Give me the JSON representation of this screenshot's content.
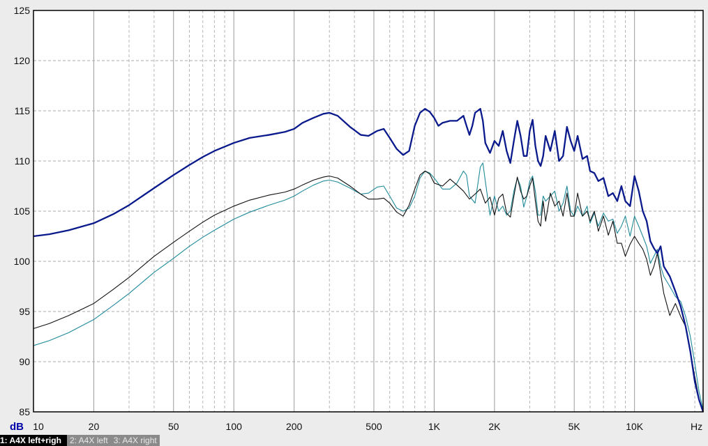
{
  "chart_data": {
    "type": "line",
    "xscale": "log",
    "xlim": [
      10,
      22000
    ],
    "ylim": [
      85,
      125
    ],
    "x_unit_label": "Hz",
    "y_unit_label": "dB",
    "y_ticks": [
      125,
      120,
      115,
      110,
      105,
      100,
      95,
      90,
      85
    ],
    "x_ticks": [
      {
        "value": 10,
        "label": "10"
      },
      {
        "value": 20,
        "label": "20"
      },
      {
        "value": 50,
        "label": "50"
      },
      {
        "value": 100,
        "label": "100"
      },
      {
        "value": 200,
        "label": "200"
      },
      {
        "value": 500,
        "label": "500"
      },
      {
        "value": 1000,
        "label": "1K"
      },
      {
        "value": 2000,
        "label": "2K"
      },
      {
        "value": 5000,
        "label": "5K"
      },
      {
        "value": 10000,
        "label": "10K"
      }
    ],
    "grid": true,
    "series": [
      {
        "name": "1: A4X left+righ",
        "color": "#0a1a8c",
        "points": [
          [
            10,
            102.5
          ],
          [
            12,
            102.7
          ],
          [
            15,
            103.1
          ],
          [
            20,
            103.8
          ],
          [
            25,
            104.7
          ],
          [
            30,
            105.6
          ],
          [
            40,
            107.3
          ],
          [
            50,
            108.6
          ],
          [
            60,
            109.6
          ],
          [
            70,
            110.4
          ],
          [
            80,
            111.0
          ],
          [
            100,
            111.8
          ],
          [
            120,
            112.3
          ],
          [
            150,
            112.6
          ],
          [
            180,
            112.9
          ],
          [
            200,
            113.2
          ],
          [
            220,
            113.8
          ],
          [
            250,
            114.3
          ],
          [
            280,
            114.7
          ],
          [
            300,
            114.8
          ],
          [
            330,
            114.5
          ],
          [
            380,
            113.4
          ],
          [
            430,
            112.6
          ],
          [
            470,
            112.5
          ],
          [
            520,
            113.0
          ],
          [
            560,
            113.2
          ],
          [
            600,
            112.3
          ],
          [
            650,
            111.2
          ],
          [
            700,
            110.6
          ],
          [
            750,
            111.0
          ],
          [
            800,
            113.5
          ],
          [
            850,
            114.8
          ],
          [
            900,
            115.2
          ],
          [
            950,
            114.9
          ],
          [
            1000,
            114.3
          ],
          [
            1050,
            113.5
          ],
          [
            1100,
            113.8
          ],
          [
            1200,
            114.0
          ],
          [
            1300,
            114.0
          ],
          [
            1400,
            114.5
          ],
          [
            1450,
            113.5
          ],
          [
            1500,
            112.6
          ],
          [
            1550,
            113.5
          ],
          [
            1600,
            114.8
          ],
          [
            1700,
            115.2
          ],
          [
            1750,
            114.0
          ],
          [
            1800,
            111.8
          ],
          [
            1900,
            110.8
          ],
          [
            2000,
            112.0
          ],
          [
            2100,
            111.5
          ],
          [
            2200,
            113.0
          ],
          [
            2300,
            111.0
          ],
          [
            2400,
            109.8
          ],
          [
            2500,
            112.0
          ],
          [
            2600,
            114.0
          ],
          [
            2700,
            112.5
          ],
          [
            2800,
            110.5
          ],
          [
            2900,
            110.5
          ],
          [
            3000,
            113.0
          ],
          [
            3100,
            114.1
          ],
          [
            3200,
            111.5
          ],
          [
            3300,
            110.0
          ],
          [
            3400,
            109.5
          ],
          [
            3500,
            110.5
          ],
          [
            3600,
            112.5
          ],
          [
            3800,
            111.0
          ],
          [
            4000,
            113.0
          ],
          [
            4200,
            110.0
          ],
          [
            4400,
            110.5
          ],
          [
            4600,
            113.4
          ],
          [
            4800,
            112.0
          ],
          [
            5000,
            111.0
          ],
          [
            5200,
            112.5
          ],
          [
            5500,
            110.2
          ],
          [
            5800,
            110.5
          ],
          [
            6000,
            109.0
          ],
          [
            6300,
            108.8
          ],
          [
            6600,
            108.0
          ],
          [
            7000,
            108.3
          ],
          [
            7400,
            106.5
          ],
          [
            7800,
            106.8
          ],
          [
            8200,
            106.0
          ],
          [
            8600,
            107.5
          ],
          [
            9000,
            106.0
          ],
          [
            9500,
            105.5
          ],
          [
            10000,
            108.5
          ],
          [
            10500,
            107.0
          ],
          [
            11000,
            105.0
          ],
          [
            11500,
            104.0
          ],
          [
            12000,
            102.0
          ],
          [
            12500,
            101.3
          ],
          [
            13000,
            100.8
          ],
          [
            13500,
            101.5
          ],
          [
            14000,
            99.5
          ],
          [
            15000,
            98.5
          ],
          [
            16000,
            97.0
          ],
          [
            17000,
            95.5
          ],
          [
            18000,
            93.5
          ],
          [
            19000,
            91.0
          ],
          [
            20000,
            88.0
          ],
          [
            21000,
            86.2
          ],
          [
            22000,
            85.0
          ]
        ]
      },
      {
        "name": "2: A4X left",
        "color": "#111111",
        "points": [
          [
            10,
            93.3
          ],
          [
            12,
            93.8
          ],
          [
            15,
            94.6
          ],
          [
            20,
            95.8
          ],
          [
            25,
            97.2
          ],
          [
            30,
            98.4
          ],
          [
            40,
            100.5
          ],
          [
            50,
            101.9
          ],
          [
            60,
            103.0
          ],
          [
            70,
            103.9
          ],
          [
            80,
            104.6
          ],
          [
            100,
            105.5
          ],
          [
            120,
            106.1
          ],
          [
            150,
            106.6
          ],
          [
            180,
            106.9
          ],
          [
            200,
            107.2
          ],
          [
            220,
            107.6
          ],
          [
            250,
            108.1
          ],
          [
            280,
            108.4
          ],
          [
            300,
            108.5
          ],
          [
            330,
            108.3
          ],
          [
            380,
            107.5
          ],
          [
            430,
            106.7
          ],
          [
            470,
            106.2
          ],
          [
            520,
            106.2
          ],
          [
            560,
            106.3
          ],
          [
            600,
            105.8
          ],
          [
            650,
            104.9
          ],
          [
            700,
            104.5
          ],
          [
            750,
            105.6
          ],
          [
            800,
            107.2
          ],
          [
            850,
            108.6
          ],
          [
            900,
            109.0
          ],
          [
            950,
            108.7
          ],
          [
            1000,
            107.8
          ],
          [
            1100,
            107.5
          ],
          [
            1200,
            108.2
          ],
          [
            1300,
            107.6
          ],
          [
            1400,
            107.0
          ],
          [
            1500,
            106.2
          ],
          [
            1600,
            106.7
          ],
          [
            1700,
            107.2
          ],
          [
            1800,
            105.8
          ],
          [
            1900,
            106.4
          ],
          [
            2000,
            104.6
          ],
          [
            2100,
            106.3
          ],
          [
            2200,
            106.7
          ],
          [
            2300,
            104.8
          ],
          [
            2400,
            104.4
          ],
          [
            2500,
            106.5
          ],
          [
            2600,
            108.4
          ],
          [
            2700,
            107.0
          ],
          [
            2800,
            106.2
          ],
          [
            2900,
            106.5
          ],
          [
            3000,
            107.5
          ],
          [
            3100,
            108.3
          ],
          [
            3200,
            106.0
          ],
          [
            3300,
            104.0
          ],
          [
            3400,
            103.5
          ],
          [
            3500,
            106.0
          ],
          [
            3600,
            104.0
          ],
          [
            3800,
            106.8
          ],
          [
            4000,
            105.5
          ],
          [
            4200,
            106.0
          ],
          [
            4400,
            104.5
          ],
          [
            4600,
            106.8
          ],
          [
            4800,
            104.5
          ],
          [
            5000,
            104.5
          ],
          [
            5200,
            106.8
          ],
          [
            5500,
            104.5
          ],
          [
            5800,
            105.0
          ],
          [
            6000,
            104.0
          ],
          [
            6300,
            105.0
          ],
          [
            6600,
            103.0
          ],
          [
            7000,
            104.5
          ],
          [
            7400,
            102.6
          ],
          [
            7800,
            104.0
          ],
          [
            8200,
            101.8
          ],
          [
            8600,
            101.8
          ],
          [
            9000,
            100.5
          ],
          [
            9500,
            101.7
          ],
          [
            10000,
            102.5
          ],
          [
            10500,
            101.8
          ],
          [
            11000,
            101.2
          ],
          [
            11500,
            100.2
          ],
          [
            12000,
            98.6
          ],
          [
            12500,
            99.5
          ],
          [
            13000,
            100.8
          ],
          [
            13500,
            98.8
          ],
          [
            14000,
            96.8
          ],
          [
            15000,
            94.6
          ],
          [
            16000,
            95.8
          ],
          [
            17000,
            94.5
          ],
          [
            18000,
            93.5
          ],
          [
            19000,
            91.0
          ],
          [
            20000,
            88.5
          ],
          [
            21000,
            86.3
          ],
          [
            22000,
            85.0
          ]
        ]
      },
      {
        "name": "3: A4X right",
        "color": "#1f8a9a",
        "points": [
          [
            10,
            91.6
          ],
          [
            12,
            92.1
          ],
          [
            15,
            92.9
          ],
          [
            20,
            94.2
          ],
          [
            25,
            95.6
          ],
          [
            30,
            96.8
          ],
          [
            40,
            98.9
          ],
          [
            50,
            100.3
          ],
          [
            60,
            101.5
          ],
          [
            70,
            102.4
          ],
          [
            80,
            103.1
          ],
          [
            100,
            104.2
          ],
          [
            120,
            104.9
          ],
          [
            150,
            105.6
          ],
          [
            180,
            106.1
          ],
          [
            200,
            106.5
          ],
          [
            220,
            107.0
          ],
          [
            250,
            107.6
          ],
          [
            280,
            108.0
          ],
          [
            300,
            108.1
          ],
          [
            330,
            107.9
          ],
          [
            380,
            107.3
          ],
          [
            430,
            106.7
          ],
          [
            470,
            106.8
          ],
          [
            520,
            107.4
          ],
          [
            560,
            107.5
          ],
          [
            600,
            106.5
          ],
          [
            650,
            105.3
          ],
          [
            700,
            105.0
          ],
          [
            750,
            105.3
          ],
          [
            800,
            106.5
          ],
          [
            850,
            108.3
          ],
          [
            900,
            109.0
          ],
          [
            950,
            108.8
          ],
          [
            1000,
            108.3
          ],
          [
            1100,
            107.2
          ],
          [
            1200,
            107.2
          ],
          [
            1300,
            107.8
          ],
          [
            1400,
            109.0
          ],
          [
            1450,
            108.6
          ],
          [
            1500,
            106.5
          ],
          [
            1600,
            105.8
          ],
          [
            1700,
            109.4
          ],
          [
            1750,
            109.8
          ],
          [
            1800,
            108.0
          ],
          [
            1900,
            104.6
          ],
          [
            2000,
            106.5
          ],
          [
            2100,
            105.0
          ],
          [
            2200,
            105.5
          ],
          [
            2300,
            104.6
          ],
          [
            2400,
            105.0
          ],
          [
            2500,
            107.0
          ],
          [
            2600,
            108.3
          ],
          [
            2700,
            107.5
          ],
          [
            2800,
            105.4
          ],
          [
            2900,
            106.5
          ],
          [
            3000,
            108.0
          ],
          [
            3100,
            108.5
          ],
          [
            3200,
            107.0
          ],
          [
            3300,
            104.6
          ],
          [
            3400,
            104.6
          ],
          [
            3500,
            106.5
          ],
          [
            3600,
            106.0
          ],
          [
            3800,
            106.5
          ],
          [
            4000,
            107.0
          ],
          [
            4200,
            105.0
          ],
          [
            4400,
            105.8
          ],
          [
            4600,
            107.5
          ],
          [
            4800,
            105.0
          ],
          [
            5000,
            104.5
          ],
          [
            5200,
            105.5
          ],
          [
            5500,
            104.5
          ],
          [
            5800,
            105.5
          ],
          [
            6000,
            103.8
          ],
          [
            6300,
            104.8
          ],
          [
            6600,
            103.5
          ],
          [
            7000,
            104.8
          ],
          [
            7400,
            104.0
          ],
          [
            7800,
            104.2
          ],
          [
            8200,
            102.8
          ],
          [
            8600,
            103.5
          ],
          [
            9000,
            104.5
          ],
          [
            9500,
            102.5
          ],
          [
            10000,
            104.5
          ],
          [
            10500,
            103.5
          ],
          [
            11000,
            102.5
          ],
          [
            11500,
            101.5
          ],
          [
            12000,
            99.8
          ],
          [
            12500,
            100.5
          ],
          [
            13000,
            101.2
          ],
          [
            13500,
            99.5
          ],
          [
            14000,
            98.5
          ],
          [
            15000,
            97.5
          ],
          [
            16000,
            96.5
          ],
          [
            17000,
            96.0
          ],
          [
            18000,
            94.5
          ],
          [
            19000,
            92.5
          ],
          [
            20000,
            89.8
          ],
          [
            21000,
            87.0
          ],
          [
            22000,
            85.2
          ]
        ]
      }
    ]
  },
  "legend": {
    "items": [
      {
        "label": "1: A4X left+righ",
        "active": true
      },
      {
        "label": "2: A4X left",
        "active": false
      },
      {
        "label": "3: A4X right",
        "active": false
      }
    ]
  }
}
